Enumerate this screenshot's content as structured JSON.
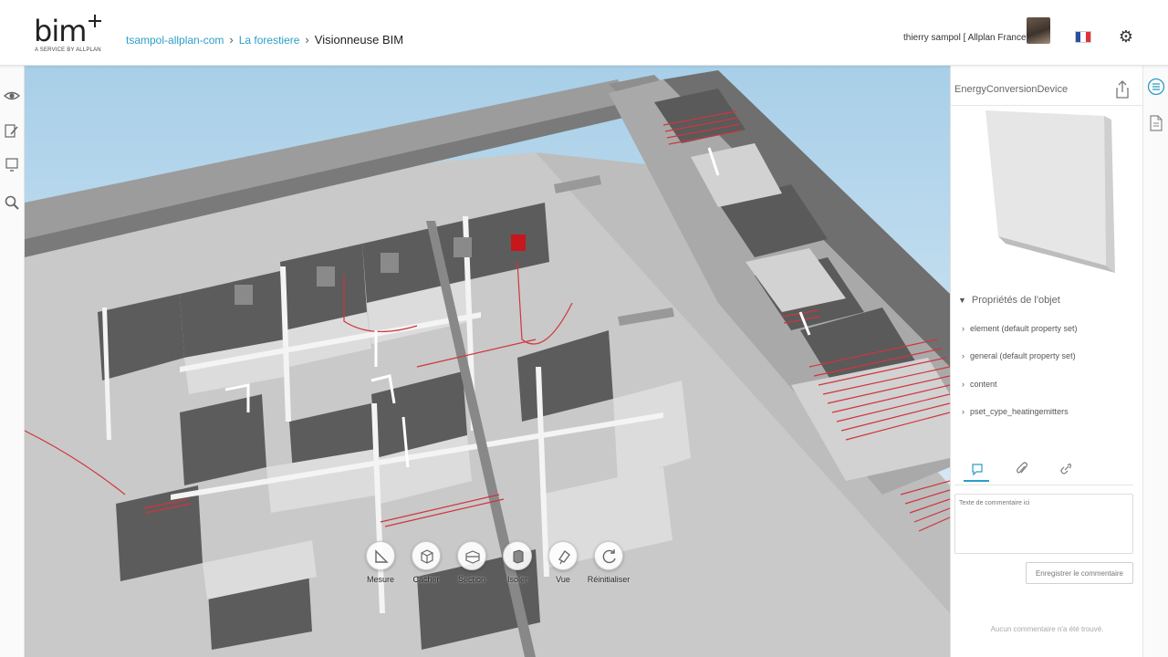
{
  "header": {
    "logo_text": "bim",
    "logo_tagline": "A SERVICE BY ALLPLAN",
    "breadcrumb": [
      "tsampol-allplan-com",
      "La forestiere",
      "Visionneuse BIM"
    ],
    "user": "thierry sampol [ Allplan France ]",
    "flag_colors": [
      "#2a4fa0",
      "#ffffff",
      "#e0323c"
    ],
    "accent_color": "#2b9ec8"
  },
  "left_toolbar": [
    "eye-icon",
    "edit-icon",
    "monitor-icon",
    "search-icon"
  ],
  "viewer": {
    "tools": [
      {
        "label": "Mesure",
        "icon": "ruler-triangle-icon"
      },
      {
        "label": "Cacher",
        "icon": "cube-hide-icon"
      },
      {
        "label": "Section",
        "icon": "section-box-icon"
      },
      {
        "label": "Isoler",
        "icon": "isolate-icon"
      },
      {
        "label": "Vue",
        "icon": "camera-view-icon"
      },
      {
        "label": "Réinitialiser",
        "icon": "reset-icon"
      }
    ]
  },
  "object_panel": {
    "title": "EnergyConversionDevice",
    "properties_heading": "Propriétés de l'objet",
    "property_sets": [
      "element (default property set)",
      "general (default property set)",
      "content",
      "pset_cype_heatingemitters"
    ],
    "comment_placeholder": "Texte de commentaire ici",
    "save_button": "Enregistrer le commentaire",
    "no_comments": "Aucun commentaire n'a été trouvé."
  }
}
